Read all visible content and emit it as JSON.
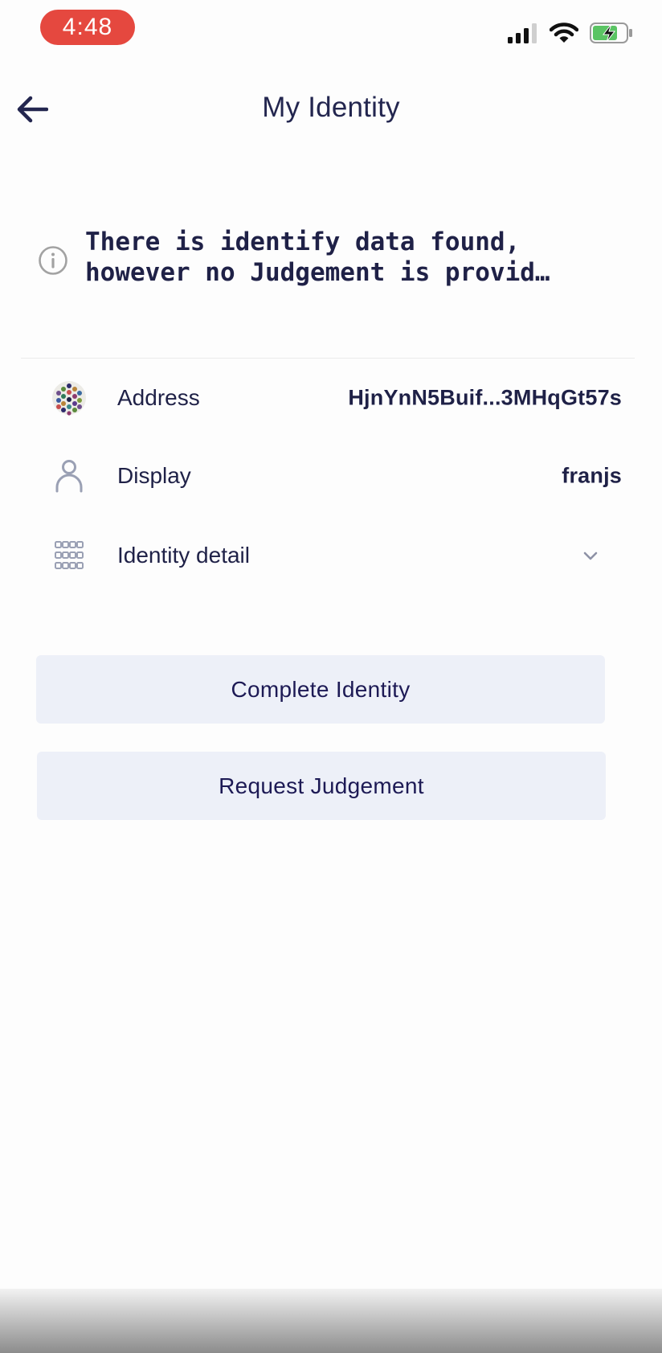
{
  "status_bar": {
    "time": "4:48",
    "time_pill_color": "#e5483f",
    "icons": [
      "cellular-signal-icon",
      "wifi-icon",
      "battery-charging-icon"
    ]
  },
  "nav": {
    "title": "My Identity",
    "back_icon": "arrow-left-icon"
  },
  "notice": {
    "icon": "info-icon",
    "text": "There is identify data found,\nhowever no Judgement is provid…"
  },
  "rows": {
    "address": {
      "icon": "identicon-avatar",
      "label": "Address",
      "value": "HjnYnN5Buif...3MHqGt57s"
    },
    "display": {
      "icon": "person-icon",
      "label": "Display",
      "value": "franjs"
    },
    "detail": {
      "icon": "grid-icon",
      "label": "Identity detail",
      "chevron": "chevron-down-icon"
    }
  },
  "buttons": {
    "complete": "Complete Identity",
    "request": "Request Judgement"
  },
  "colors": {
    "text_primary": "#1f2147",
    "button_bg": "#edf0f8",
    "icon_gray": "#9aa0b4"
  }
}
